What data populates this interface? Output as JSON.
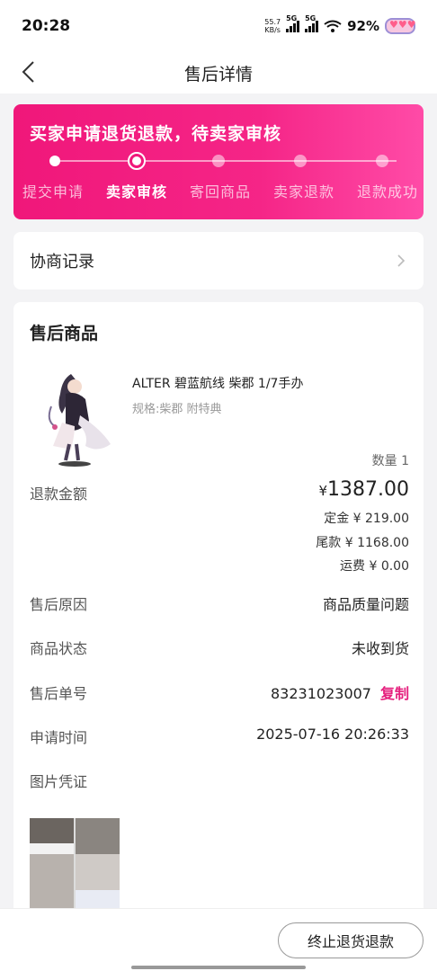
{
  "status_bar": {
    "time": "20:28",
    "net_speed_value": "55.7",
    "net_speed_unit": "KB/s",
    "signal1": "5G",
    "signal2": "5G",
    "battery": "92%"
  },
  "nav": {
    "title": "售后详情"
  },
  "progress": {
    "title": "买家申请退货退款，待卖家审核",
    "steps": [
      "提交申请",
      "卖家审核",
      "寄回商品",
      "卖家退款",
      "退款成功"
    ],
    "current_step": 1
  },
  "negotiation": {
    "label": "协商记录"
  },
  "detail": {
    "section_title": "售后商品",
    "product_name": "ALTER 碧蓝航线 柴郡 1/7手办",
    "spec": "规格:柴郡 附特典",
    "quantity": "数量 1",
    "refund_label": "退款金额",
    "refund_currency": "¥",
    "refund_amount": "1387.00",
    "deposit": "定金 ¥ 219.00",
    "balance": "尾款 ¥ 1168.00",
    "shipping": "运费 ¥ 0.00",
    "reason_label": "售后原因",
    "reason_value": "商品质量问题",
    "goods_status_label": "商品状态",
    "goods_status_value": "未收到货",
    "order_no_label": "售后单号",
    "order_no_value": "83231023007",
    "copy_label": "复制",
    "time_label": "申请时间",
    "time_value": "2025-07-16 20:26:33",
    "proof_label": "图片凭证"
  },
  "bottom": {
    "end_button": "终止退货退款"
  },
  "colors": {
    "accent": "#f0177a",
    "copy": "#e5207e"
  }
}
